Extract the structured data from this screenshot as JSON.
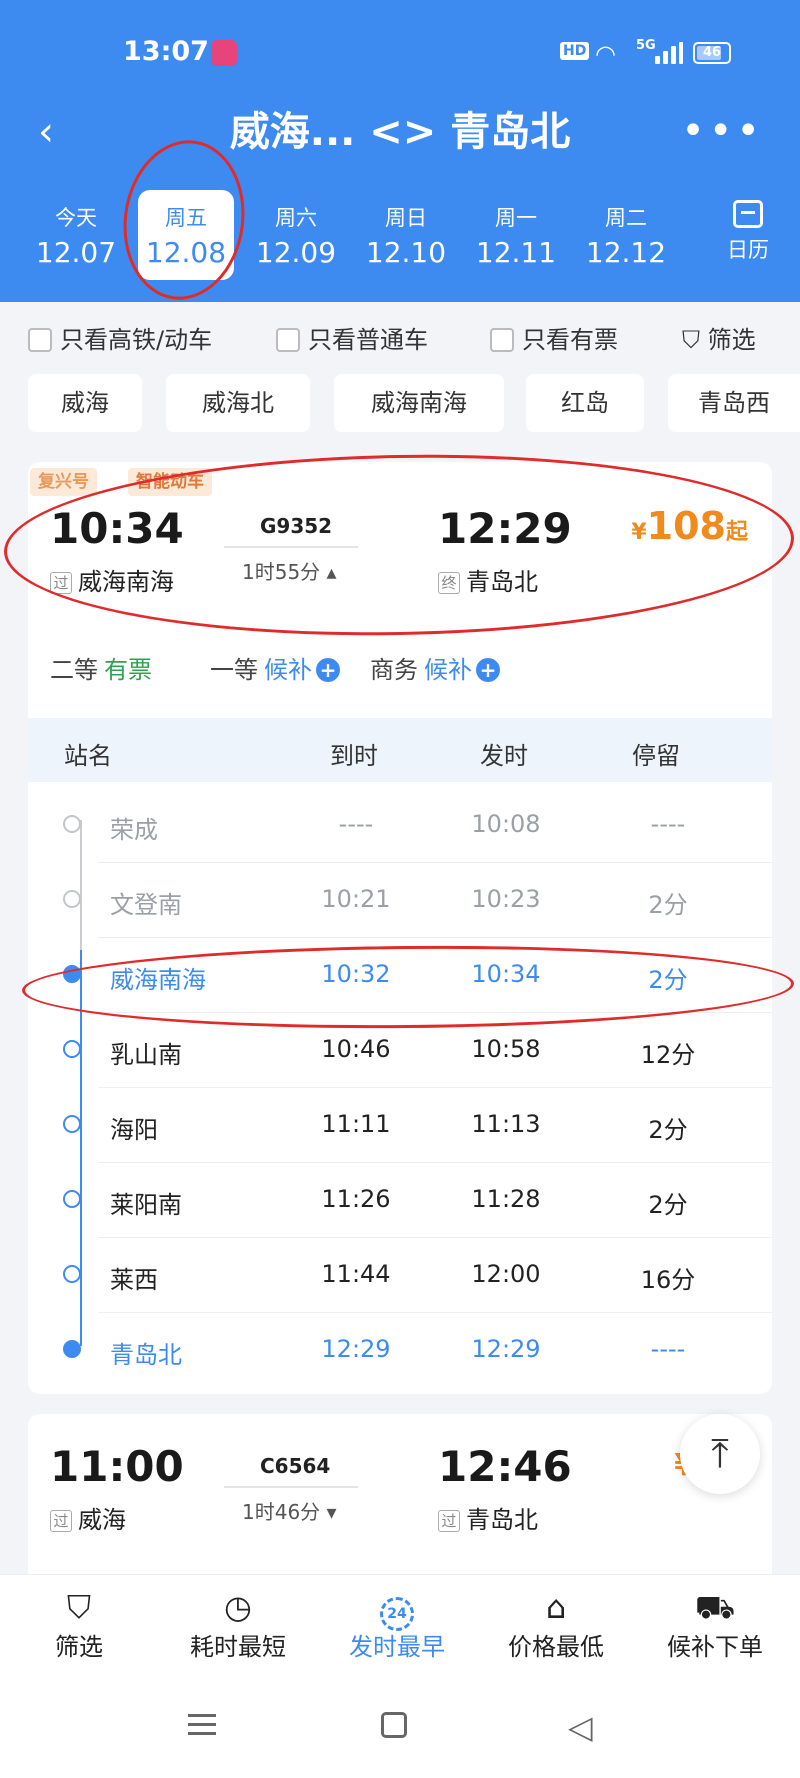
{
  "status": {
    "time": "13:07",
    "hd": "HD",
    "net": "5G",
    "battery": "46"
  },
  "nav": {
    "title": "威海... <> 青岛北",
    "back": "‹",
    "more": "•••"
  },
  "dates": [
    {
      "weekday": "今天",
      "date": "12.07"
    },
    {
      "weekday": "周五",
      "date": "12.08",
      "selected": true
    },
    {
      "weekday": "周六",
      "date": "12.09"
    },
    {
      "weekday": "周日",
      "date": "12.10"
    },
    {
      "weekday": "周一",
      "date": "12.11"
    },
    {
      "weekday": "周二",
      "date": "12.12"
    }
  ],
  "calendar_label": "日历",
  "filters": {
    "high_speed": "只看高铁/动车",
    "normal": "只看普通车",
    "has_ticket": "只看有票",
    "filter": "筛选"
  },
  "stations": [
    "威海",
    "威海北",
    "威海南海",
    "红岛",
    "青岛西"
  ],
  "train1": {
    "tags": [
      "复兴号",
      "智能动车"
    ],
    "dep_time": "10:34",
    "arr_time": "12:29",
    "train_no": "G9352",
    "duration": "1时55分",
    "dep_mark": "过",
    "dep_station": "威海南海",
    "arr_mark": "终",
    "arr_station": "青岛北",
    "price_symbol": "¥",
    "price": "108",
    "price_suffix": "起",
    "seats": [
      {
        "class": "二等",
        "status": "有票"
      },
      {
        "class": "一等",
        "status": "候补"
      },
      {
        "class": "商务",
        "status": "候补"
      }
    ],
    "schedule_headers": {
      "station": "站名",
      "arrive": "到时",
      "depart": "发时",
      "stay": "停留"
    },
    "schedule": [
      {
        "station": "荣成",
        "arrive": "----",
        "depart": "10:08",
        "stay": "----",
        "state": "passed"
      },
      {
        "station": "文登南",
        "arrive": "10:21",
        "depart": "10:23",
        "stay": "2分",
        "state": "passed"
      },
      {
        "station": "威海南海",
        "arrive": "10:32",
        "depart": "10:34",
        "stay": "2分",
        "state": "hl"
      },
      {
        "station": "乳山南",
        "arrive": "10:46",
        "depart": "10:58",
        "stay": "12分",
        "state": "normal"
      },
      {
        "station": "海阳",
        "arrive": "11:11",
        "depart": "11:13",
        "stay": "2分",
        "state": "normal"
      },
      {
        "station": "莱阳南",
        "arrive": "11:26",
        "depart": "11:28",
        "stay": "2分",
        "state": "normal"
      },
      {
        "station": "莱西",
        "arrive": "11:44",
        "depart": "12:00",
        "stay": "16分",
        "state": "normal"
      },
      {
        "station": "青岛北",
        "arrive": "12:29",
        "depart": "12:29",
        "stay": "----",
        "state": "hl"
      }
    ]
  },
  "train2": {
    "dep_time": "11:00",
    "arr_time": "12:46",
    "train_no": "C6564",
    "duration": "1时46分",
    "dep_mark": "过",
    "dep_station": "威海",
    "arr_mark": "过",
    "arr_station": "青岛北",
    "price_partial": "¥8"
  },
  "scroll_top": "⤒",
  "bottom_tabs": [
    {
      "label": "筛选",
      "icon": "funnel-icon"
    },
    {
      "label": "耗时最短",
      "icon": "stopwatch-icon"
    },
    {
      "label": "发时最早",
      "icon": "24-icon",
      "badge": "24",
      "active": true
    },
    {
      "label": "价格最低",
      "icon": "tag-icon"
    },
    {
      "label": "候补下单",
      "icon": "cart-icon"
    }
  ],
  "colors": {
    "primary": "#3d8bf0",
    "price": "#f08a1c",
    "available": "#2fa14f",
    "annotation": "#e02b2b"
  }
}
